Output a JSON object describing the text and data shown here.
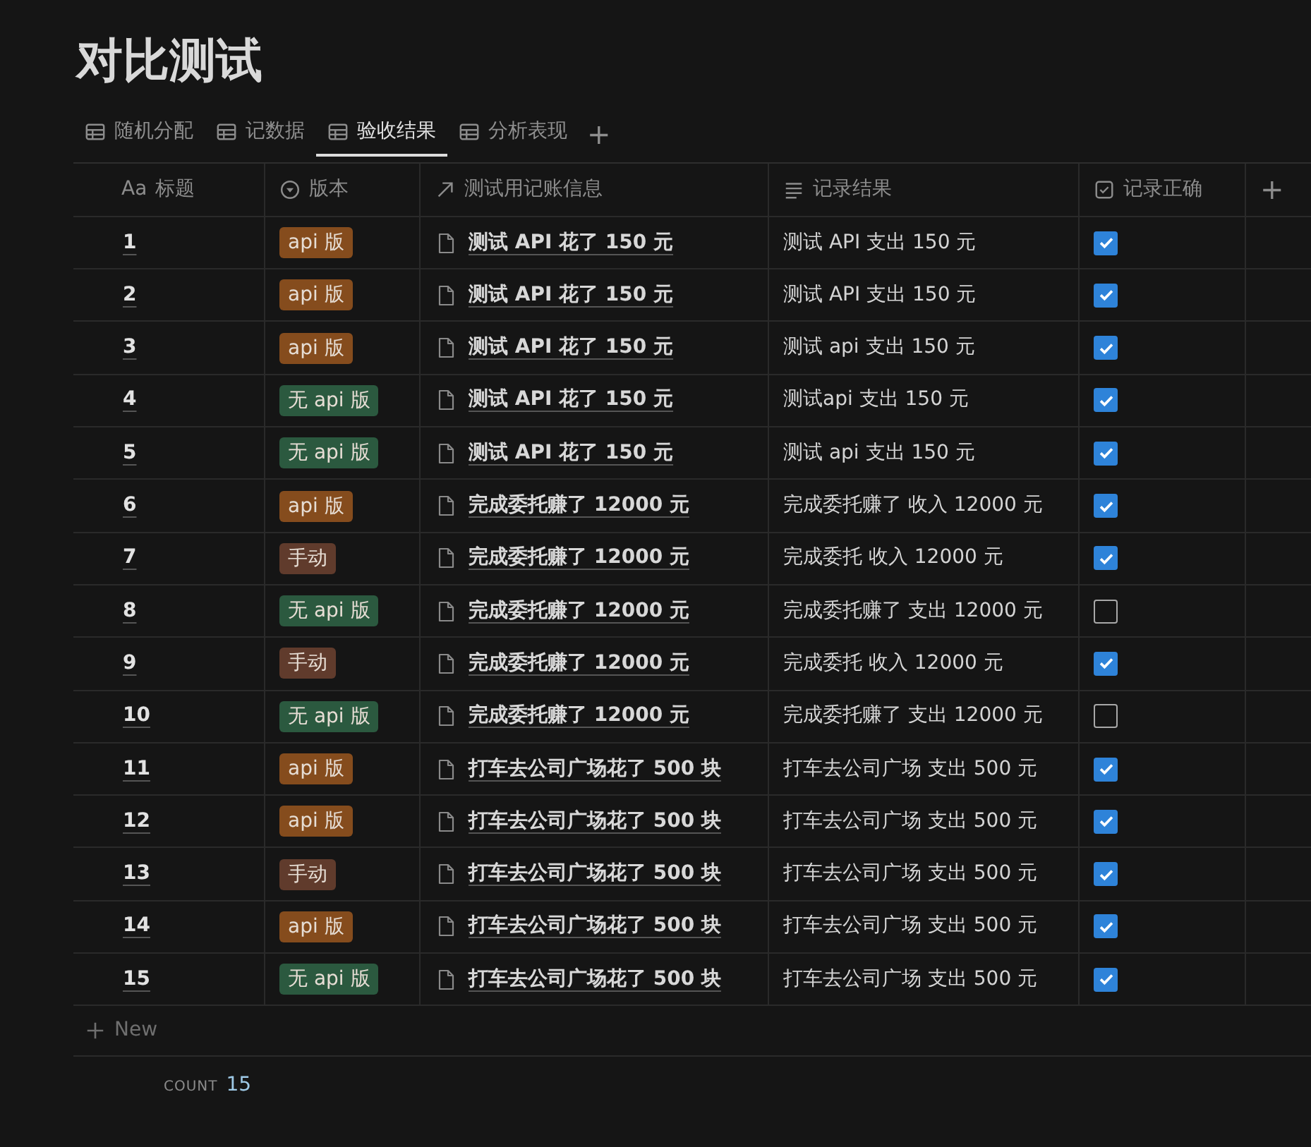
{
  "page": {
    "title": "对比测试"
  },
  "tabs": [
    {
      "label": "随机分配",
      "selected": false
    },
    {
      "label": "记数据",
      "selected": false
    },
    {
      "label": "验收结果",
      "selected": true
    },
    {
      "label": "分析表现",
      "selected": false
    }
  ],
  "add_view": "+",
  "table": {
    "columns": [
      {
        "label": "标题",
        "kind": "title",
        "icon_text": "Aa"
      },
      {
        "label": "版本",
        "kind": "select"
      },
      {
        "label": "测试用记账信息",
        "kind": "relation"
      },
      {
        "label": "记录结果",
        "kind": "text"
      },
      {
        "label": "记录正确",
        "kind": "checkbox"
      }
    ],
    "add_column": "+",
    "rows": [
      {
        "title": "1",
        "tag": {
          "label": "api 版",
          "color": "#854c1d"
        },
        "input": "测试 API 花了 150 元",
        "result": "测试 API 支出 150 元",
        "correct": true
      },
      {
        "title": "2",
        "tag": {
          "label": "api 版",
          "color": "#854c1d"
        },
        "input": "测试 API 花了 150 元",
        "result": "测试 API 支出 150 元",
        "correct": true
      },
      {
        "title": "3",
        "tag": {
          "label": "api 版",
          "color": "#854c1d"
        },
        "input": "测试 API 花了 150 元",
        "result": "测试 api 支出 150 元",
        "correct": true
      },
      {
        "title": "4",
        "tag": {
          "label": "无 api 版",
          "color": "#2b593f"
        },
        "input": "测试 API 花了 150 元",
        "result": "测试api 支出 150 元",
        "correct": true
      },
      {
        "title": "5",
        "tag": {
          "label": "无 api 版",
          "color": "#2b593f"
        },
        "input": "测试 API 花了 150 元",
        "result": "测试 api 支出 150 元",
        "correct": true
      },
      {
        "title": "6",
        "tag": {
          "label": "api 版",
          "color": "#854c1d"
        },
        "input": "完成委托赚了 12000 元",
        "result": "完成委托赚了 收入 12000 元",
        "correct": true
      },
      {
        "title": "7",
        "tag": {
          "label": "手动",
          "color": "#603b2c"
        },
        "input": "完成委托赚了 12000 元",
        "result": "完成委托 收入 12000 元",
        "correct": true
      },
      {
        "title": "8",
        "tag": {
          "label": "无 api 版",
          "color": "#2b593f"
        },
        "input": "完成委托赚了 12000 元",
        "result": "完成委托赚了 支出 12000 元",
        "correct": false
      },
      {
        "title": "9",
        "tag": {
          "label": "手动",
          "color": "#603b2c"
        },
        "input": "完成委托赚了 12000 元",
        "result": "完成委托 收入 12000 元",
        "correct": true
      },
      {
        "title": "10",
        "tag": {
          "label": "无 api 版",
          "color": "#2b593f"
        },
        "input": "完成委托赚了 12000 元",
        "result": "完成委托赚了 支出 12000 元",
        "correct": false
      },
      {
        "title": "11",
        "tag": {
          "label": "api 版",
          "color": "#854c1d"
        },
        "input": "打车去公司广场花了 500 块",
        "result": "打车去公司广场 支出 500 元",
        "correct": true
      },
      {
        "title": "12",
        "tag": {
          "label": "api 版",
          "color": "#854c1d"
        },
        "input": "打车去公司广场花了 500 块",
        "result": "打车去公司广场 支出 500 元",
        "correct": true
      },
      {
        "title": "13",
        "tag": {
          "label": "手动",
          "color": "#603b2c"
        },
        "input": "打车去公司广场花了 500 块",
        "result": "打车去公司广场 支出 500 元",
        "correct": true
      },
      {
        "title": "14",
        "tag": {
          "label": "api 版",
          "color": "#854c1d"
        },
        "input": "打车去公司广场花了 500 块",
        "result": "打车去公司广场 支出 500 元",
        "correct": true
      },
      {
        "title": "15",
        "tag": {
          "label": "无 api 版",
          "color": "#2b593f"
        },
        "input": "打车去公司广场花了 500 块",
        "result": "打车去公司广场 支出 500 元",
        "correct": true
      }
    ],
    "new_row": "New",
    "footer": {
      "label": "COUNT",
      "value": "15"
    }
  }
}
